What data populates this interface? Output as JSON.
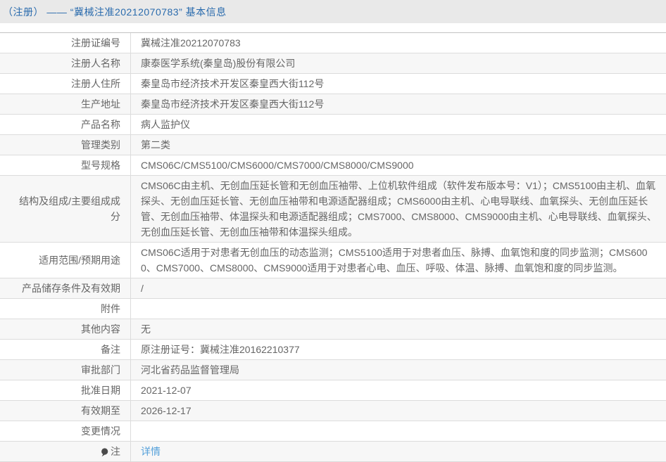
{
  "header": {
    "title": "（注册） —— “冀械注准20212070783” 基本信息",
    "background": "#e9e9e9",
    "text_color": "#2a6bad"
  },
  "colors": {
    "row_alt_background": "#f7f7f7",
    "row_background": "#ffffff",
    "divider": "#dcdcdc",
    "table_top_border": "#c3c3c3",
    "text": "#666666",
    "link": "#54a0da"
  },
  "table": {
    "rows": [
      {
        "label": "注册证编号",
        "value": "冀械注准20212070783"
      },
      {
        "label": "注册人名称",
        "value": "康泰医学系统(秦皇岛)股份有限公司"
      },
      {
        "label": "注册人住所",
        "value": "秦皇岛市经济技术开发区秦皇西大街112号"
      },
      {
        "label": "生产地址",
        "value": "秦皇岛市经济技术开发区秦皇西大街112号"
      },
      {
        "label": "产品名称",
        "value": "病人监护仪"
      },
      {
        "label": "管理类别",
        "value": "第二类"
      },
      {
        "label": "型号规格",
        "value": "CMS06C/CMS5100/CMS6000/CMS7000/CMS8000/CMS9000"
      },
      {
        "label": "结构及组成/主要组成成分",
        "value": "CMS06C由主机、无创血压延长管和无创血压袖带、上位机软件组成（软件发布版本号：V1）；CMS5100由主机、血氧探头、无创血压延长管、无创血压袖带和电源适配器组成；CMS6000由主机、心电导联线、血氧探头、无创血压延长管、无创血压袖带、体温探头和电源适配器组成；CMS7000、CMS8000、CMS9000由主机、心电导联线、血氧探头、无创血压延长管、无创血压袖带和体温探头组成。"
      },
      {
        "label": "适用范围/预期用途",
        "value": "CMS06C适用于对患者无创血压的动态监测；CMS5100适用于对患者血压、脉搏、血氧饱和度的同步监测；CMS6000、CMS7000、CMS8000、CMS9000适用于对患者心电、血压、呼吸、体温、脉搏、血氧饱和度的同步监测。"
      },
      {
        "label": "产品储存条件及有效期",
        "value": "/"
      },
      {
        "label": "附件",
        "value": ""
      },
      {
        "label": "其他内容",
        "value": "无"
      },
      {
        "label": "备注",
        "value": "原注册证号：冀械注准20162210377"
      },
      {
        "label": "审批部门",
        "value": "河北省药品监督管理局"
      },
      {
        "label": "批准日期",
        "value": "2021-12-07"
      },
      {
        "label": "有效期至",
        "value": "2026-12-17"
      },
      {
        "label": "变更情况",
        "value": ""
      },
      {
        "label": "注",
        "icon": "note-bulb-icon",
        "value": "详情",
        "link": true
      }
    ]
  }
}
